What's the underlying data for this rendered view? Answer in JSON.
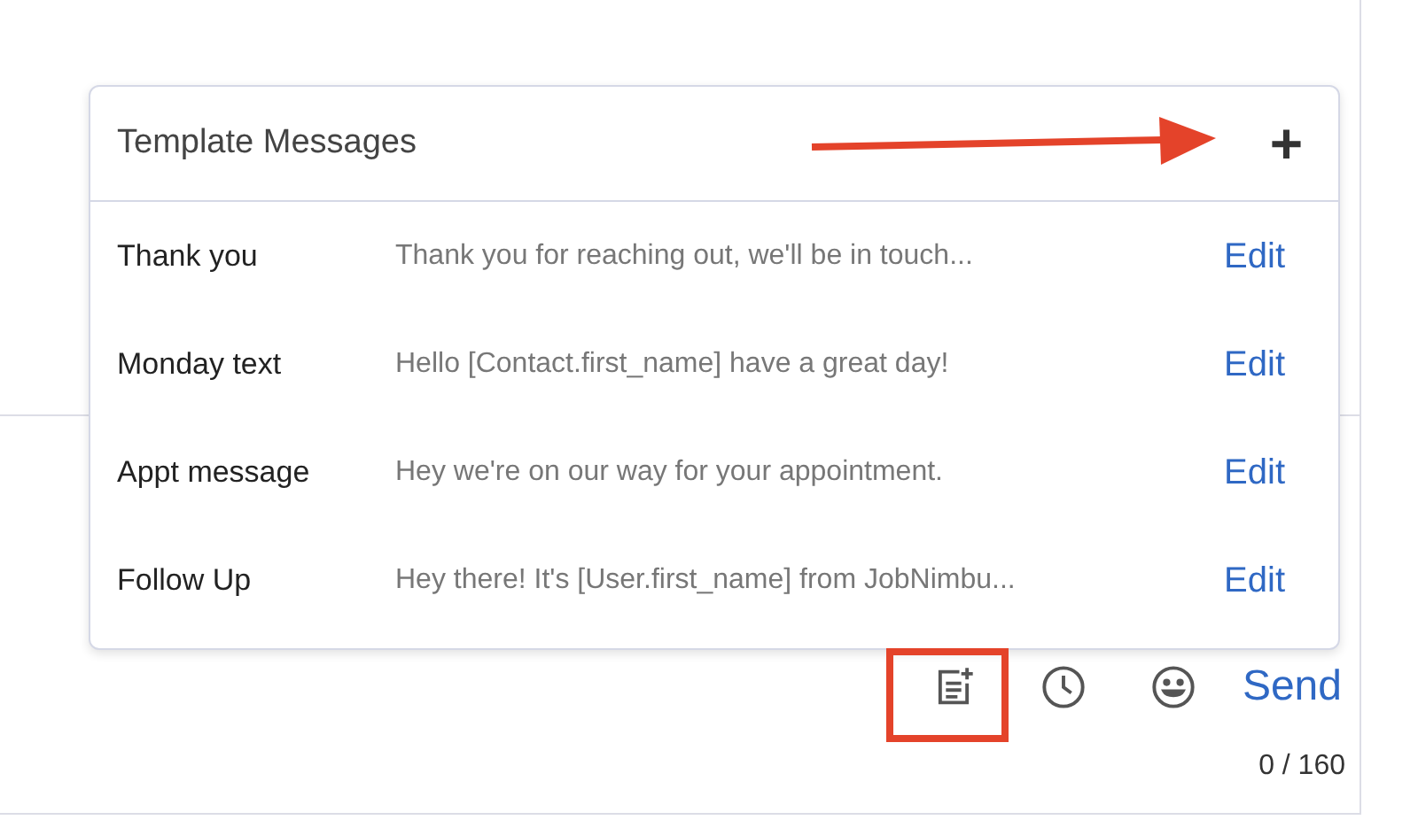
{
  "template_popup": {
    "title": "Template Messages",
    "add_button": "+",
    "templates": [
      {
        "name": "Thank you",
        "preview": "Thank you for reaching out, we'll be in touch...",
        "action": "Edit"
      },
      {
        "name": "Monday text",
        "preview": "Hello [Contact.first_name] have a great day!",
        "action": "Edit"
      },
      {
        "name": "Appt message",
        "preview": "Hey we're on our way for your appointment.",
        "action": "Edit"
      },
      {
        "name": "Follow Up",
        "preview": "Hey there! It's [User.first_name] from JobNimbu...",
        "action": "Edit"
      }
    ]
  },
  "composer": {
    "send_button": "Send",
    "character_count": "0 / 160"
  }
}
